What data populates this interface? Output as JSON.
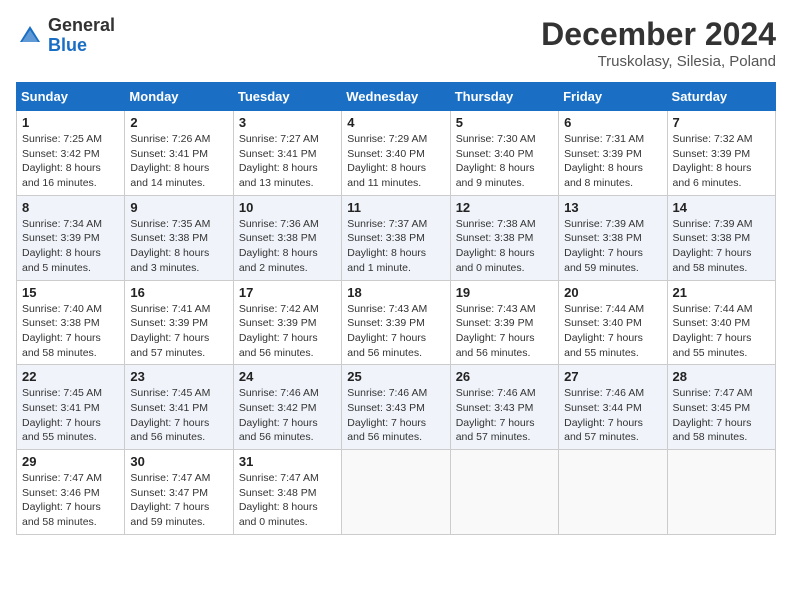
{
  "header": {
    "logo_general": "General",
    "logo_blue": "Blue",
    "month_title": "December 2024",
    "location": "Truskolasy, Silesia, Poland"
  },
  "weekdays": [
    "Sunday",
    "Monday",
    "Tuesday",
    "Wednesday",
    "Thursday",
    "Friday",
    "Saturday"
  ],
  "weeks": [
    [
      {
        "day": "1",
        "sunrise": "Sunrise: 7:25 AM",
        "sunset": "Sunset: 3:42 PM",
        "daylight": "Daylight: 8 hours and 16 minutes."
      },
      {
        "day": "2",
        "sunrise": "Sunrise: 7:26 AM",
        "sunset": "Sunset: 3:41 PM",
        "daylight": "Daylight: 8 hours and 14 minutes."
      },
      {
        "day": "3",
        "sunrise": "Sunrise: 7:27 AM",
        "sunset": "Sunset: 3:41 PM",
        "daylight": "Daylight: 8 hours and 13 minutes."
      },
      {
        "day": "4",
        "sunrise": "Sunrise: 7:29 AM",
        "sunset": "Sunset: 3:40 PM",
        "daylight": "Daylight: 8 hours and 11 minutes."
      },
      {
        "day": "5",
        "sunrise": "Sunrise: 7:30 AM",
        "sunset": "Sunset: 3:40 PM",
        "daylight": "Daylight: 8 hours and 9 minutes."
      },
      {
        "day": "6",
        "sunrise": "Sunrise: 7:31 AM",
        "sunset": "Sunset: 3:39 PM",
        "daylight": "Daylight: 8 hours and 8 minutes."
      },
      {
        "day": "7",
        "sunrise": "Sunrise: 7:32 AM",
        "sunset": "Sunset: 3:39 PM",
        "daylight": "Daylight: 8 hours and 6 minutes."
      }
    ],
    [
      {
        "day": "8",
        "sunrise": "Sunrise: 7:34 AM",
        "sunset": "Sunset: 3:39 PM",
        "daylight": "Daylight: 8 hours and 5 minutes."
      },
      {
        "day": "9",
        "sunrise": "Sunrise: 7:35 AM",
        "sunset": "Sunset: 3:38 PM",
        "daylight": "Daylight: 8 hours and 3 minutes."
      },
      {
        "day": "10",
        "sunrise": "Sunrise: 7:36 AM",
        "sunset": "Sunset: 3:38 PM",
        "daylight": "Daylight: 8 hours and 2 minutes."
      },
      {
        "day": "11",
        "sunrise": "Sunrise: 7:37 AM",
        "sunset": "Sunset: 3:38 PM",
        "daylight": "Daylight: 8 hours and 1 minute."
      },
      {
        "day": "12",
        "sunrise": "Sunrise: 7:38 AM",
        "sunset": "Sunset: 3:38 PM",
        "daylight": "Daylight: 8 hours and 0 minutes."
      },
      {
        "day": "13",
        "sunrise": "Sunrise: 7:39 AM",
        "sunset": "Sunset: 3:38 PM",
        "daylight": "Daylight: 7 hours and 59 minutes."
      },
      {
        "day": "14",
        "sunrise": "Sunrise: 7:39 AM",
        "sunset": "Sunset: 3:38 PM",
        "daylight": "Daylight: 7 hours and 58 minutes."
      }
    ],
    [
      {
        "day": "15",
        "sunrise": "Sunrise: 7:40 AM",
        "sunset": "Sunset: 3:38 PM",
        "daylight": "Daylight: 7 hours and 58 minutes."
      },
      {
        "day": "16",
        "sunrise": "Sunrise: 7:41 AM",
        "sunset": "Sunset: 3:39 PM",
        "daylight": "Daylight: 7 hours and 57 minutes."
      },
      {
        "day": "17",
        "sunrise": "Sunrise: 7:42 AM",
        "sunset": "Sunset: 3:39 PM",
        "daylight": "Daylight: 7 hours and 56 minutes."
      },
      {
        "day": "18",
        "sunrise": "Sunrise: 7:43 AM",
        "sunset": "Sunset: 3:39 PM",
        "daylight": "Daylight: 7 hours and 56 minutes."
      },
      {
        "day": "19",
        "sunrise": "Sunrise: 7:43 AM",
        "sunset": "Sunset: 3:39 PM",
        "daylight": "Daylight: 7 hours and 56 minutes."
      },
      {
        "day": "20",
        "sunrise": "Sunrise: 7:44 AM",
        "sunset": "Sunset: 3:40 PM",
        "daylight": "Daylight: 7 hours and 55 minutes."
      },
      {
        "day": "21",
        "sunrise": "Sunrise: 7:44 AM",
        "sunset": "Sunset: 3:40 PM",
        "daylight": "Daylight: 7 hours and 55 minutes."
      }
    ],
    [
      {
        "day": "22",
        "sunrise": "Sunrise: 7:45 AM",
        "sunset": "Sunset: 3:41 PM",
        "daylight": "Daylight: 7 hours and 55 minutes."
      },
      {
        "day": "23",
        "sunrise": "Sunrise: 7:45 AM",
        "sunset": "Sunset: 3:41 PM",
        "daylight": "Daylight: 7 hours and 56 minutes."
      },
      {
        "day": "24",
        "sunrise": "Sunrise: 7:46 AM",
        "sunset": "Sunset: 3:42 PM",
        "daylight": "Daylight: 7 hours and 56 minutes."
      },
      {
        "day": "25",
        "sunrise": "Sunrise: 7:46 AM",
        "sunset": "Sunset: 3:43 PM",
        "daylight": "Daylight: 7 hours and 56 minutes."
      },
      {
        "day": "26",
        "sunrise": "Sunrise: 7:46 AM",
        "sunset": "Sunset: 3:43 PM",
        "daylight": "Daylight: 7 hours and 57 minutes."
      },
      {
        "day": "27",
        "sunrise": "Sunrise: 7:46 AM",
        "sunset": "Sunset: 3:44 PM",
        "daylight": "Daylight: 7 hours and 57 minutes."
      },
      {
        "day": "28",
        "sunrise": "Sunrise: 7:47 AM",
        "sunset": "Sunset: 3:45 PM",
        "daylight": "Daylight: 7 hours and 58 minutes."
      }
    ],
    [
      {
        "day": "29",
        "sunrise": "Sunrise: 7:47 AM",
        "sunset": "Sunset: 3:46 PM",
        "daylight": "Daylight: 7 hours and 58 minutes."
      },
      {
        "day": "30",
        "sunrise": "Sunrise: 7:47 AM",
        "sunset": "Sunset: 3:47 PM",
        "daylight": "Daylight: 7 hours and 59 minutes."
      },
      {
        "day": "31",
        "sunrise": "Sunrise: 7:47 AM",
        "sunset": "Sunset: 3:48 PM",
        "daylight": "Daylight: 8 hours and 0 minutes."
      },
      null,
      null,
      null,
      null
    ]
  ]
}
